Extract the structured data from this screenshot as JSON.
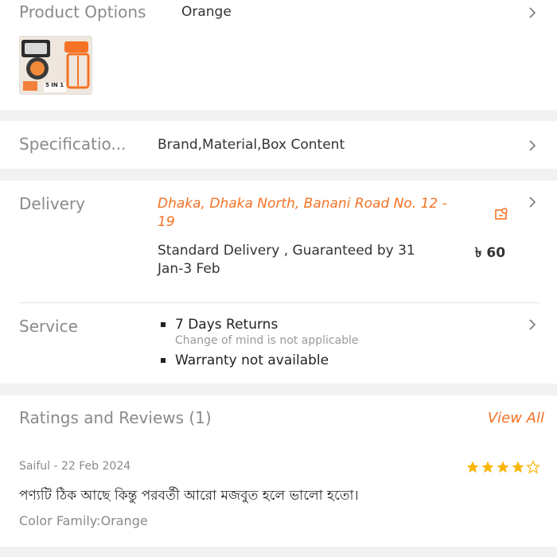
{
  "product_options": {
    "label": "Product Options",
    "value": "Orange",
    "thumbnail_caption": "5 IN 1"
  },
  "specifications": {
    "label": "Specificatio...",
    "value": "Brand,Material,Box Content"
  },
  "delivery": {
    "label": "Delivery",
    "address_line1": "Dhaka, Dhaka North, Banani Road No. 12 -",
    "address_line2": "19",
    "option_line1": "Standard Delivery , Guaranteed by 31",
    "option_line2": "Jan-3 Feb",
    "price": "৳ 60"
  },
  "service": {
    "label": "Service",
    "item1_title": "7 Days Returns",
    "item1_sub": "Change of mind is not applicable",
    "item2_title": "Warranty not available"
  },
  "ratings": {
    "title": "Ratings and Reviews (1)",
    "view_all": "View All",
    "review": {
      "author_date": "Saiful - 22 Feb 2024",
      "stars": 4,
      "max_stars": 5,
      "text": "পণ্যটি ঠিক আছে কিন্তু পরবর্তী আরো মজবুত হলে ভালো হতো।",
      "variant": "Color Family:Orange"
    }
  },
  "colors": {
    "accent": "#f57224",
    "star": "#fbb60b",
    "label": "#8a8a8a",
    "background": "#f2f2f2"
  }
}
